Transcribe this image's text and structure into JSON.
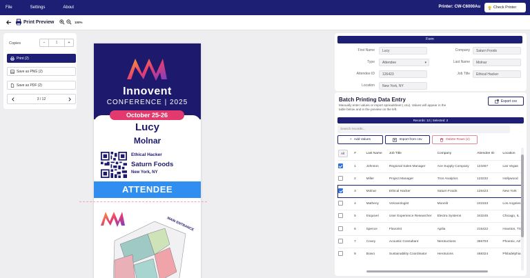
{
  "menubar": {
    "items": [
      "File",
      "Settings",
      "About"
    ],
    "printer": "Printer: CW-C6000Au",
    "check_printer": "Check Printer"
  },
  "toolbar": {
    "title": "Print Preview",
    "zoom": "100%"
  },
  "left": {
    "copies_label": "Copies",
    "copies_value": "1",
    "print_label": "Print (2)",
    "png_label": "Save as PNG (2)",
    "pdf_label": "Save as PDF (2)",
    "page": "3 / 12"
  },
  "badge": {
    "event_line1": "Innovent",
    "event_line2": "CONFERENCE | 2025",
    "date": "October 25-26",
    "first_name": "Lucy",
    "last_name": "Molnar",
    "job_title": "Ethical Hacker",
    "company": "Saturn Foods",
    "location": "New York, NY",
    "role": "ATTENDEE",
    "map_label": "MAIN ENTRANCE"
  },
  "form": {
    "header": "Form",
    "first_name_label": "First Name",
    "first_name": "Lucy",
    "type_label": "Type",
    "type": "Attendee",
    "attendee_id_label": "Attendee ID",
    "attendee_id": "126423",
    "location_label": "Location",
    "location": "New York, NY",
    "company_label": "Company",
    "company": "Saturn Foods",
    "last_name_label": "Last Name",
    "last_name": "Molnar",
    "job_title_label": "Job Title",
    "job_title": "Ethical Hacker"
  },
  "batch": {
    "title": "Batch Printing Data Entry",
    "description": "Manually enter values or import spreadsheet (.csv). Values will appear in the table below and in the preview on the left.",
    "export_label": "Export csv",
    "records": "Records: 12 | Selected: 2",
    "search_placeholder": "Search records...",
    "add_label": "Add Values",
    "import_label": "Import from csv",
    "delete_label": "Delete Rows (2)",
    "all_label": "All",
    "columns": [
      "#",
      "Last Name",
      "Job Title",
      "Company",
      "Attendee ID",
      "Location"
    ],
    "rows": [
      {
        "n": "1",
        "last": "Johnson",
        "job": "Regional Sales Manager",
        "company": "Ace Supply Company",
        "id": "123457",
        "loc": "Las Vegas"
      },
      {
        "n": "2",
        "last": "Miller",
        "job": "Project Manager",
        "company": "Tron Analytics",
        "id": "123232",
        "loc": "Hollywood"
      },
      {
        "n": "3",
        "last": "Molnar",
        "job": "Ethical Hacker",
        "company": "Saturn Foods",
        "id": "126423",
        "loc": "New York"
      },
      {
        "n": "4",
        "last": "Matheny",
        "job": "Volcanologist",
        "company": "Moonlit",
        "id": "243153",
        "loc": "Los Angeles"
      },
      {
        "n": "5",
        "last": "Esquivel",
        "job": "User Experience Researcher",
        "company": "Electra Systems",
        "id": "343245",
        "loc": "Chicago, IL"
      },
      {
        "n": "6",
        "last": "Spence",
        "job": "Flavorist",
        "company": "Apilia",
        "id": "215422",
        "loc": "Houston, TX"
      },
      {
        "n": "7",
        "last": "Covey",
        "job": "Acoustic Consultant",
        "company": "Nerotuctions",
        "id": "356703",
        "loc": "Phoenix, AZ"
      },
      {
        "n": "8",
        "last": "Bravo",
        "job": "Sustainability Coordinator",
        "company": "Herotuions",
        "id": "468324",
        "loc": "Philadelphia"
      }
    ]
  }
}
